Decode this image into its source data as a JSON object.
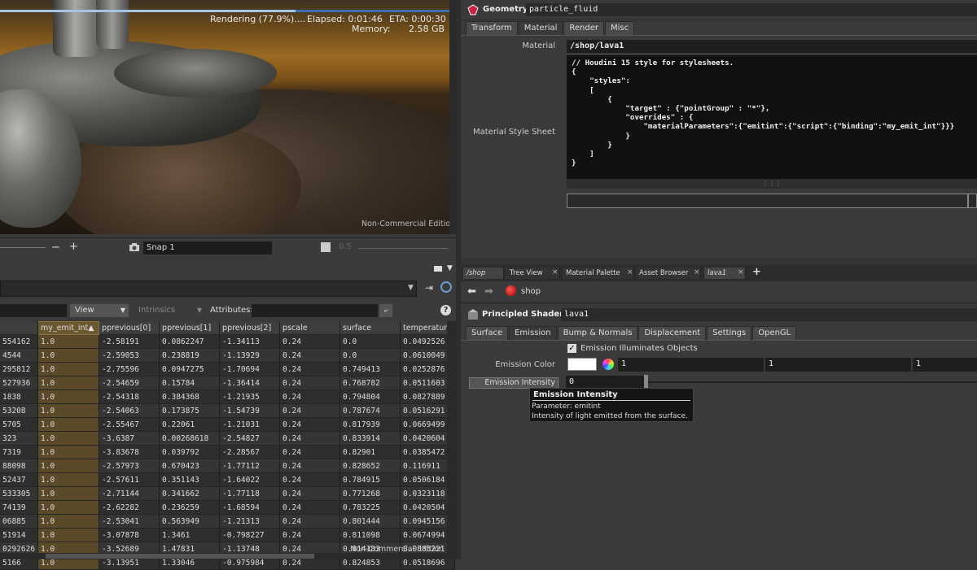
{
  "viewport": {
    "status": "Rendering (77.9%)....",
    "elapsed": "Elapsed: 0:01:46",
    "eta": "ETA: 0:00:30",
    "memory_label": "Memory:",
    "memory_value": "2.58 GB",
    "watermark": "Non-Commercial Edition",
    "progress": 0.779
  },
  "viewport_bar": {
    "minus": "−",
    "plus": "+",
    "snap_value": "Snap  1",
    "scale_value": "0.5"
  },
  "spreadsheet": {
    "view_label": "View",
    "intrinsics_label": "Intrinsics",
    "attributes_label": "Attributes:",
    "columns": [
      "",
      "my_emit_int▲",
      "pprevious[0]",
      "pprevious[1]",
      "pprevious[2]",
      "pscale",
      "surface",
      "temperature"
    ],
    "rows": [
      [
        "554162",
        "1.0",
        "-2.58191",
        "0.0862247",
        "-1.34113",
        "0.24",
        "0.0",
        "0.0492526"
      ],
      [
        "4544",
        "1.0",
        "-2.59053",
        "0.238819",
        "-1.13929",
        "0.24",
        "0.0",
        "0.0610049"
      ],
      [
        "295812",
        "1.0",
        "-2.75596",
        "0.0947275",
        "-1.70694",
        "0.24",
        "0.749413",
        "0.0252876"
      ],
      [
        "527936",
        "1.0",
        "-2.54659",
        "0.15784",
        "-1.36414",
        "0.24",
        "0.768782",
        "0.0511603"
      ],
      [
        "1838",
        "1.0",
        "-2.54318",
        "0.384368",
        "-1.21935",
        "0.24",
        "0.794804",
        "0.0827889"
      ],
      [
        "53208",
        "1.0",
        "-2.54063",
        "0.173875",
        "-1.54739",
        "0.24",
        "0.787674",
        "0.0516291"
      ],
      [
        "5705",
        "1.0",
        "-2.55467",
        "0.22061",
        "-1.21031",
        "0.24",
        "0.817939",
        "0.0669499"
      ],
      [
        "323",
        "1.0",
        "-3.6387",
        "0.00268618",
        "-2.54827",
        "0.24",
        "0.833914",
        "0.0420604"
      ],
      [
        "7319",
        "1.0",
        "-3.83678",
        "0.039792",
        "-2.28567",
        "0.24",
        "0.82901",
        "0.0385472"
      ],
      [
        "88098",
        "1.0",
        "-2.57973",
        "0.670423",
        "-1.77112",
        "0.24",
        "0.828652",
        "0.116911"
      ],
      [
        "52437",
        "1.0",
        "-2.57611",
        "0.351143",
        "-1.64022",
        "0.24",
        "0.784915",
        "0.0506184"
      ],
      [
        "533305",
        "1.0",
        "-2.71144",
        "0.341662",
        "-1.77118",
        "0.24",
        "0.771268",
        "0.0323118"
      ],
      [
        "74139",
        "1.0",
        "-2.62282",
        "0.236259",
        "-1.68594",
        "0.24",
        "0.783225",
        "0.0420504"
      ],
      [
        "06885",
        "1.0",
        "-2.53041",
        "0.563949",
        "-1.21313",
        "0.24",
        "0.801444",
        "0.0945156"
      ],
      [
        "51914",
        "1.0",
        "-3.07878",
        "1.3461",
        "-0.798227",
        "0.24",
        "0.811098",
        "0.0674994"
      ],
      [
        "0292626",
        "1.0",
        "-3.52689",
        "1.47831",
        "-1.13748",
        "0.24",
        "0.814183",
        "0.0385221"
      ],
      [
        "5166",
        "1.0",
        "-3.13951",
        "1.33046",
        "-0.975984",
        "0.24",
        "0.824853",
        "0.0518696"
      ]
    ],
    "watermark": "Non-Commercial Edition"
  },
  "params": {
    "node_type": "Geometry",
    "node_name": "particle_fluid",
    "tabs": [
      "Transform",
      "Material",
      "Render",
      "Misc"
    ],
    "selected_tab": 1,
    "material_label": "Material",
    "material_value": "/shop/lava1",
    "style_sheet_label": "Material Style Sheet",
    "style_sheet_text": "// Houdini 15 style for stylesheets.\n{\n    \"styles\":\n    [\n        {\n            \"target\" : {\"pointGroup\" : \"*\"},\n            \"overrides\" : {\n                \"materialParameters\":{\"emitint\":{\"script\":{\"binding\":\"my_emit_int\"}}}\n            }\n        }\n    ]\n}"
  },
  "desk_tabs": [
    "/shop",
    "Tree View",
    "Material Palette",
    "Asset Browser",
    "lava1"
  ],
  "network": {
    "path": "shop"
  },
  "shader": {
    "type": "Principled Shader",
    "name": "lava1",
    "tabs": [
      "Surface",
      "Emission",
      "Bump & Normals",
      "Displacement",
      "Settings",
      "OpenGL"
    ],
    "selected_tab": 1,
    "illuminates_label": "Emission Illuminates Objects",
    "emission_color_label": "Emission Color",
    "emission_color": [
      "1",
      "1",
      "1"
    ],
    "emission_intensity_label": "Emission Intensity",
    "emission_intensity_value": "0"
  },
  "tooltip": {
    "title": "Emission Intensity",
    "parameter": "Parameter: emitint",
    "description": "Intensity of light emitted from the surface."
  }
}
